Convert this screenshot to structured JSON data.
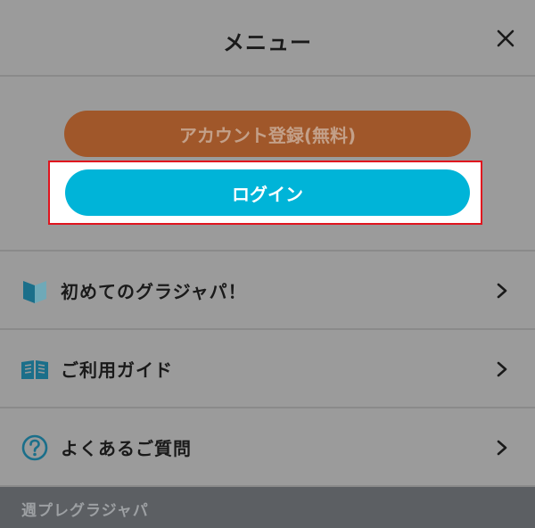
{
  "header": {
    "title": "メニュー",
    "close_icon": "close-icon"
  },
  "auth": {
    "register_label": "アカウント登録(無料)",
    "login_label": "ログイン"
  },
  "menu": {
    "items": [
      {
        "label": "初めてのグラジャパ！",
        "icon": "beginner-leaf-icon"
      },
      {
        "label": "ご利用ガイド",
        "icon": "book-icon"
      },
      {
        "label": "よくあるご質問",
        "icon": "question-icon"
      }
    ]
  },
  "footer": {
    "section_label": "週プレグラジャパ"
  },
  "colors": {
    "overlay": "#9b9b9b",
    "register": "#a0572a",
    "login": "#00b4d8",
    "highlight": "#e0141e",
    "icon": "#1b6f8a",
    "footer": "#5c5f63"
  }
}
